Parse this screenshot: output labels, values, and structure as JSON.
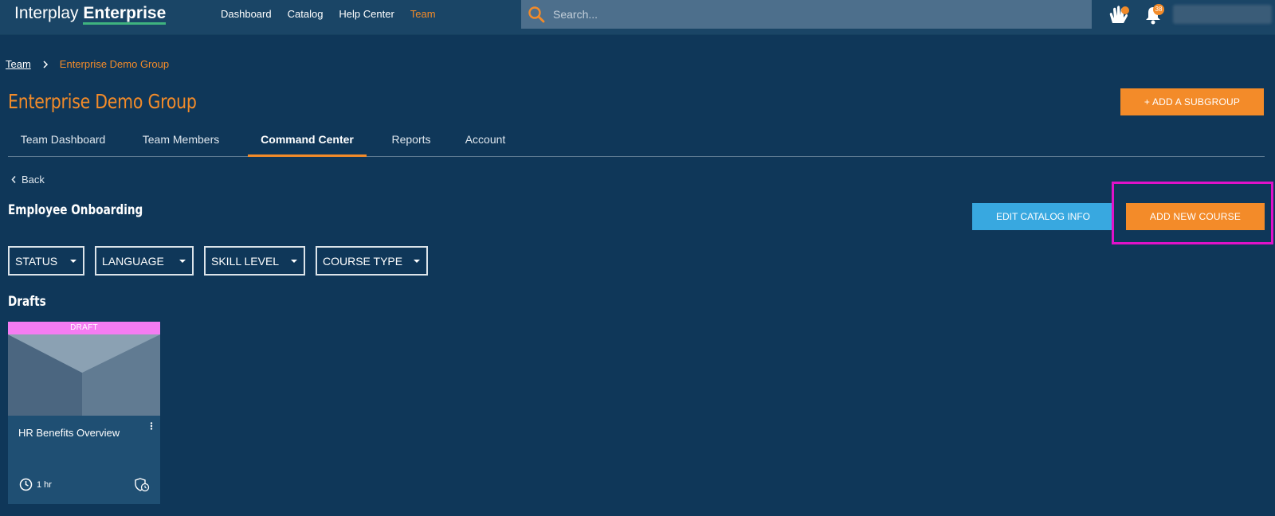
{
  "header": {
    "logo_plain": "Interplay",
    "logo_bold": "Enterprise",
    "nav": [
      "Dashboard",
      "Catalog",
      "Help Center",
      "Team"
    ],
    "active_nav": "Team",
    "search_placeholder": "Search...",
    "notifications_count": "38"
  },
  "breadcrumb": {
    "root": "Team",
    "current": "Enterprise Demo Group"
  },
  "page": {
    "title": "Enterprise Demo Group",
    "add_subgroup_label": "+ ADD A SUBGROUP"
  },
  "tabs": [
    {
      "label": "Team Dashboard"
    },
    {
      "label": "Team Members"
    },
    {
      "label": "Command Center",
      "active": true
    },
    {
      "label": "Reports"
    },
    {
      "label": "Account"
    }
  ],
  "back_label": "Back",
  "catalog": {
    "title": "Employee Onboarding",
    "edit_label": "EDIT CATALOG INFO",
    "add_course_label": "ADD NEW COURSE"
  },
  "filters": [
    {
      "label": "STATUS"
    },
    {
      "label": "LANGUAGE"
    },
    {
      "label": "SKILL LEVEL"
    },
    {
      "label": "COURSE TYPE"
    }
  ],
  "drafts": {
    "heading": "Drafts",
    "courses": [
      {
        "badge": "DRAFT",
        "title": "HR Benefits Overview",
        "duration": "1 hr"
      }
    ]
  },
  "colors": {
    "background": "#0f3759",
    "header": "#1a4566",
    "accent": "#f38b29",
    "blue_button": "#38a8e0",
    "draft_badge": "#f57cf2",
    "highlight": "#e012c9"
  }
}
